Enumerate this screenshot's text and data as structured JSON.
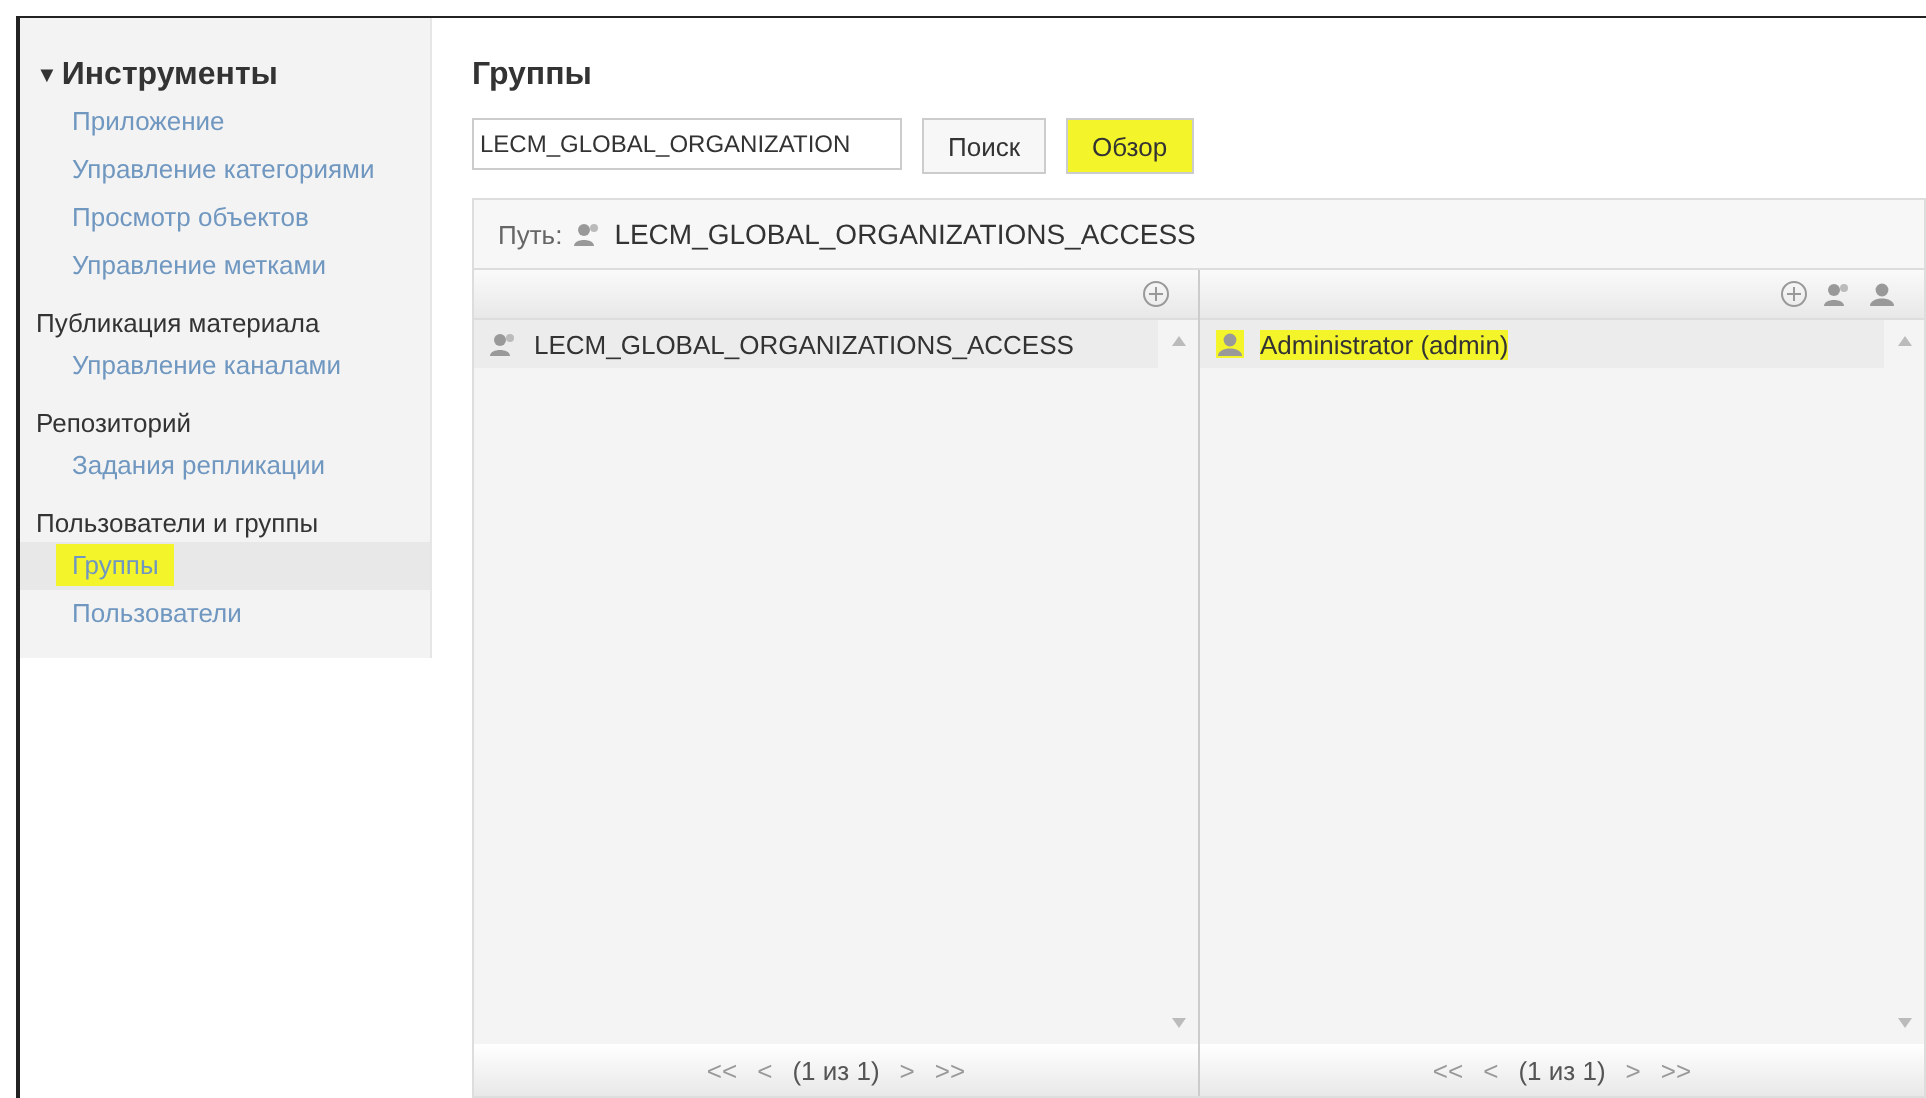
{
  "sidebar": {
    "root": {
      "toggle": "▼",
      "label": "Инструменты",
      "expanded": true,
      "items": [
        {
          "label": "Приложение",
          "selected": false,
          "highlighted": false
        },
        {
          "label": "Управление категориями",
          "selected": false,
          "highlighted": false
        },
        {
          "label": "Просмотр объектов",
          "selected": false,
          "highlighted": false
        },
        {
          "label": "Управление метками",
          "selected": false,
          "highlighted": false
        }
      ]
    },
    "sections": [
      {
        "label": "Публикация материала",
        "items": [
          {
            "label": "Управление каналами",
            "selected": false,
            "highlighted": false
          }
        ]
      },
      {
        "label": "Репозиторий",
        "items": [
          {
            "label": "Задания репликации",
            "selected": false,
            "highlighted": false
          }
        ]
      },
      {
        "label": "Пользователи и группы",
        "items": [
          {
            "label": "Группы",
            "selected": true,
            "highlighted": true
          },
          {
            "label": "Пользователи",
            "selected": false,
            "highlighted": false
          }
        ]
      }
    ]
  },
  "main": {
    "title": "Группы",
    "search": {
      "value": "LECM_GLOBAL_ORGANIZATION"
    },
    "buttons": [
      {
        "label": "Поиск",
        "highlighted": false
      },
      {
        "label": "Обзор",
        "highlighted": true
      }
    ],
    "path": {
      "label": "Путь:",
      "value": "LECM_GLOBAL_ORGANIZATIONS_ACCESS"
    },
    "panes": [
      {
        "kind": "groups",
        "rows": [
          {
            "kind": "group",
            "label": "LECM_GLOBAL_ORGANIZATIONS_ACCESS",
            "highlighted": false
          }
        ],
        "pager": {
          "first": "<<",
          "prev": "<",
          "info": "(1 из 1)",
          "next": ">",
          "last": ">>"
        }
      },
      {
        "kind": "members",
        "rows": [
          {
            "kind": "user",
            "label": "Administrator (admin)",
            "highlighted": true
          }
        ],
        "pager": {
          "first": "<<",
          "prev": "<",
          "info": "(1 из 1)",
          "next": ">",
          "last": ">>"
        }
      }
    ]
  }
}
